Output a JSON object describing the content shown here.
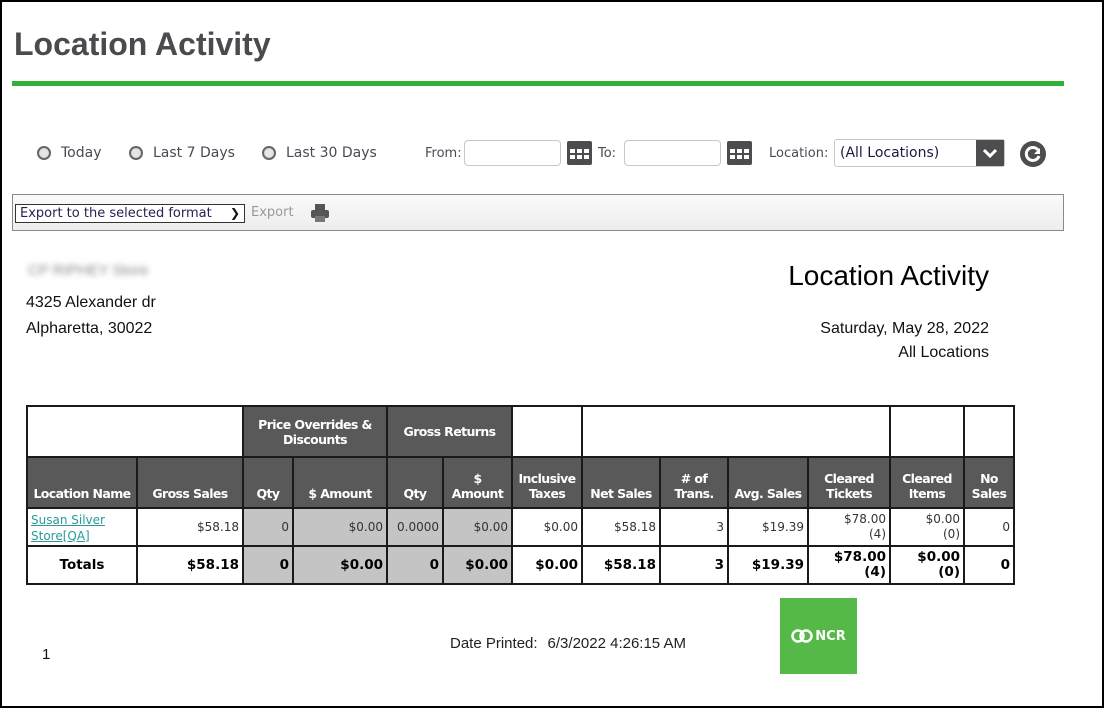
{
  "page": {
    "title": "Location Activity"
  },
  "filters": {
    "radios": [
      {
        "label": "Today"
      },
      {
        "label": "Last 7 Days"
      },
      {
        "label": "Last 30 Days"
      }
    ],
    "from_label": "From:",
    "from_value": "",
    "to_label": "To:",
    "to_value": "",
    "location_label": "Location:",
    "location_value": "(All Locations)"
  },
  "toolbar": {
    "export_format": "Export to the selected format",
    "export_label": "Export"
  },
  "report": {
    "store_name": "CP RIPHEY Store",
    "address_line1": "4325 Alexander dr",
    "address_line2": "Alpharetta,  30022",
    "title": "Location Activity",
    "date": "Saturday, May 28, 2022",
    "location": "All Locations",
    "groups": {
      "price_overrides": "Price Overrides & Discounts",
      "gross_returns": "Gross Returns"
    },
    "columns": [
      "Location Name",
      "Gross Sales",
      "Qty",
      "$ Amount",
      "Qty",
      "$ Amount",
      "Inclusive Taxes",
      "Net Sales",
      "# of Trans.",
      "Avg. Sales",
      "Cleared Tickets",
      "Cleared Items",
      "No Sales"
    ],
    "rows": [
      {
        "location_name": "Susan Silver Store[QA]",
        "gross_sales": "$58.18",
        "po_qty": "0",
        "po_amount": "$0.00",
        "gr_qty": "0.0000",
        "gr_amount": "$0.00",
        "inclusive_taxes": "$0.00",
        "net_sales": "$58.18",
        "num_trans": "3",
        "avg_sales": "$19.39",
        "cleared_tickets_amount": "$78.00",
        "cleared_tickets_count": "(4)",
        "cleared_items_amount": "$0.00",
        "cleared_items_count": "(0)",
        "no_sales": "0"
      }
    ],
    "totals": {
      "label": "Totals",
      "gross_sales": "$58.18",
      "po_qty": "0",
      "po_amount": "$0.00",
      "gr_qty": "0",
      "gr_amount": "$0.00",
      "inclusive_taxes": "$0.00",
      "net_sales": "$58.18",
      "num_trans": "3",
      "avg_sales": "$19.39",
      "cleared_tickets_amount": "$78.00",
      "cleared_tickets_count": "(4)",
      "cleared_items_amount": "$0.00",
      "cleared_items_count": "(0)",
      "no_sales": "0"
    },
    "page_number": "1",
    "date_printed_label": "Date Printed:",
    "date_printed_value": "6/3/2022 4:26:15 AM",
    "logo_text": "NCR"
  },
  "colors": {
    "accent_green": "#2eb135",
    "header_grey": "#595959",
    "logo_green": "#55b947"
  }
}
